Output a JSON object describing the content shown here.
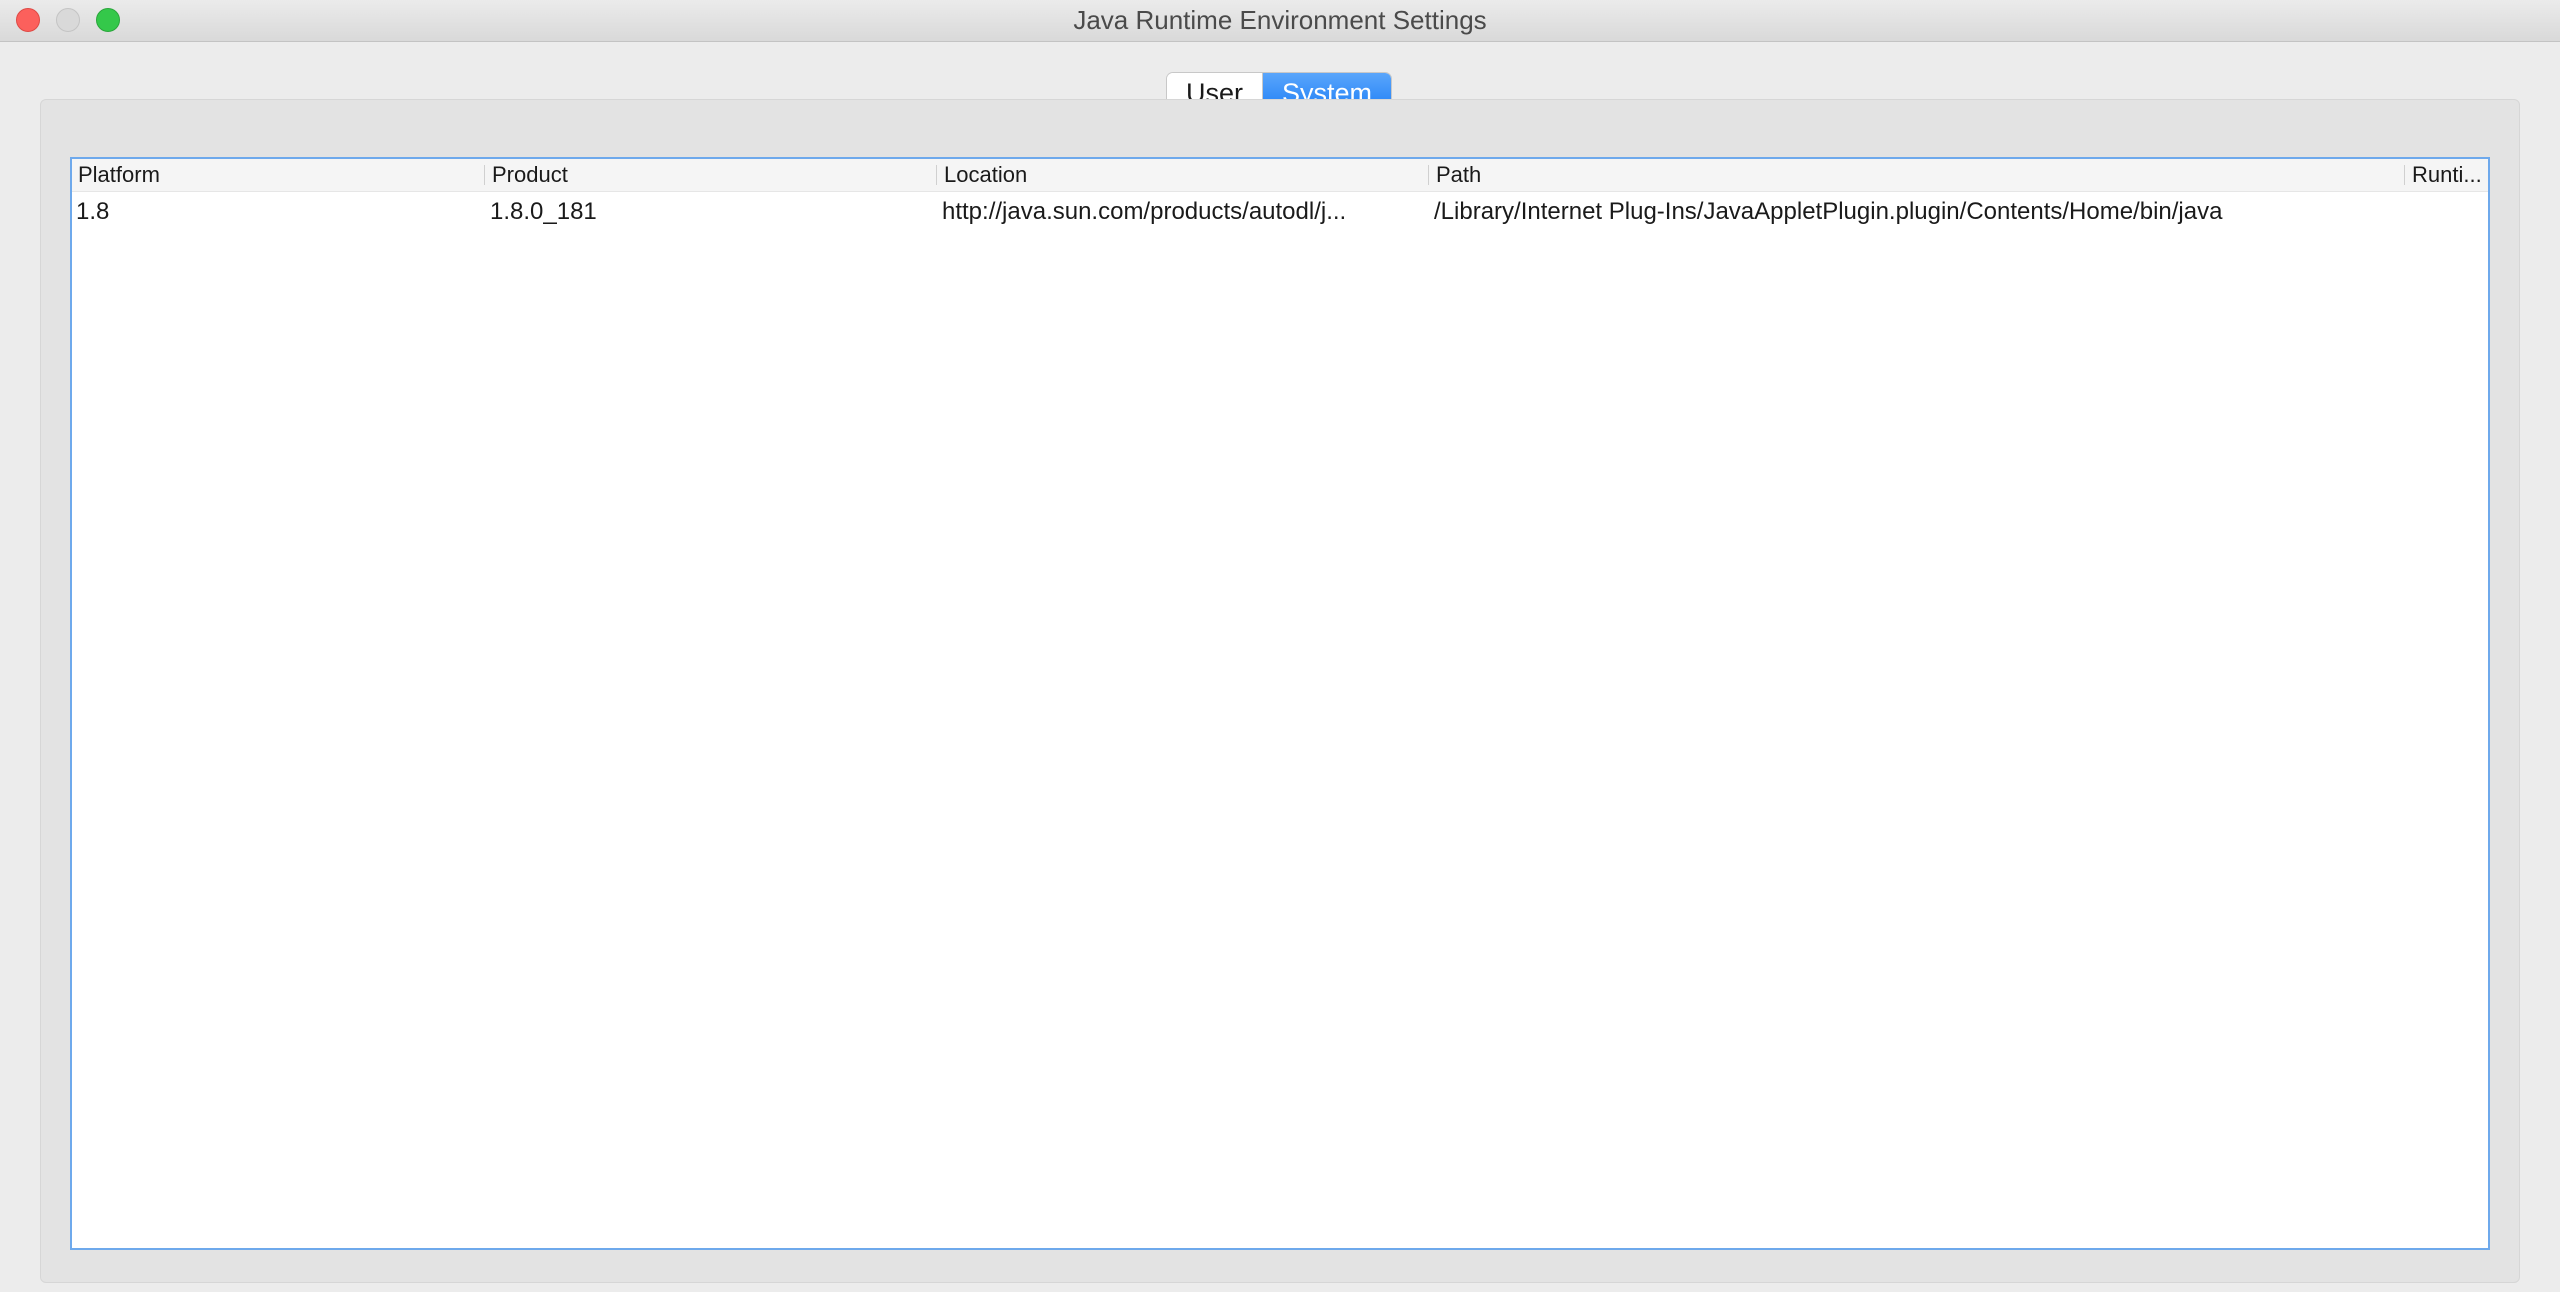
{
  "window": {
    "title": "Java Runtime Environment Settings"
  },
  "tabs": [
    {
      "label": "User",
      "selected": false
    },
    {
      "label": "System",
      "selected": true
    }
  ],
  "table": {
    "columns": [
      "Platform",
      "Product",
      "Location",
      "Path",
      "Runti..."
    ],
    "rows": [
      {
        "platform": "1.8",
        "product": "1.8.0_181",
        "location": "http://java.sun.com/products/autodl/j...",
        "path": "/Library/Internet Plug-Ins/JavaAppletPlugin.plugin/Contents/Home/bin/java",
        "runtime": ""
      }
    ]
  },
  "colors": {
    "accent": "#1d7df6",
    "table_border": "#6ea9ec",
    "close": "#fc605c",
    "zoom": "#34c84a"
  }
}
